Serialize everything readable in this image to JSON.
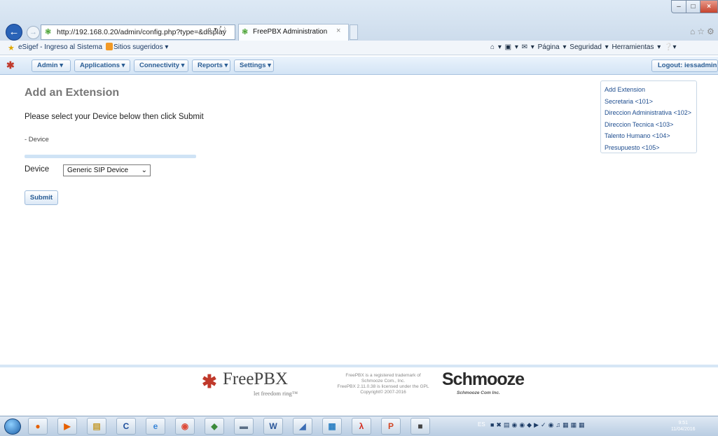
{
  "browser": {
    "url": "http://192.168.0.20/admin/config.php?type=&display",
    "address_tools": "⌕ ▾ ↻",
    "tab_title": "FreePBX Administration",
    "favorites": {
      "items": [
        "eSigef - Ingreso al Sistema",
        "Sitios sugeridos ▾"
      ]
    },
    "command_bar": "⌂ ▾ ▣ ▾ ✉ ▾ Página ▾  Seguridad ▾  Herramientas ▾  ❔▾"
  },
  "menu": {
    "items": [
      {
        "label": "Admin ▾"
      },
      {
        "label": "Applications ▾"
      },
      {
        "label": "Connectivity ▾"
      },
      {
        "label": "Reports ▾"
      },
      {
        "label": "Settings ▾"
      }
    ],
    "logout": "Logout: iessadmin"
  },
  "content": {
    "title": "Add an Extension",
    "instructions": "Please select your Device below then click Submit",
    "section_label": "- Device",
    "device_label": "Device",
    "device_value": "Generic SIP Device",
    "submit_label": "Submit"
  },
  "sidebar": {
    "items": [
      "Add Extension",
      "Secretaria <101>",
      "Direccion Administrativa <102>",
      "Direccion Tecnica <103>",
      "Talento Humano <104>",
      "Presupuesto <105>"
    ]
  },
  "footer": {
    "brand": "FreePBX",
    "tagline": "let freedom ring™",
    "legal": [
      "FreePBX is a registered trademark of",
      "Schmooze Com., Inc.",
      "FreePBX 2.11.0.38 is licensed under the GPL",
      "Copyright© 2007-2016"
    ],
    "sponsor": "Schmooze",
    "sponsor_sub": "Schmooze Com Inc."
  },
  "taskbar": {
    "language": "ES",
    "time": "9:51",
    "date": "11/04/2016"
  },
  "colors": {
    "accent": "#2a5d94",
    "menu_bg": "#d3e4f5",
    "sidebar_link": "#1e4d8f"
  }
}
